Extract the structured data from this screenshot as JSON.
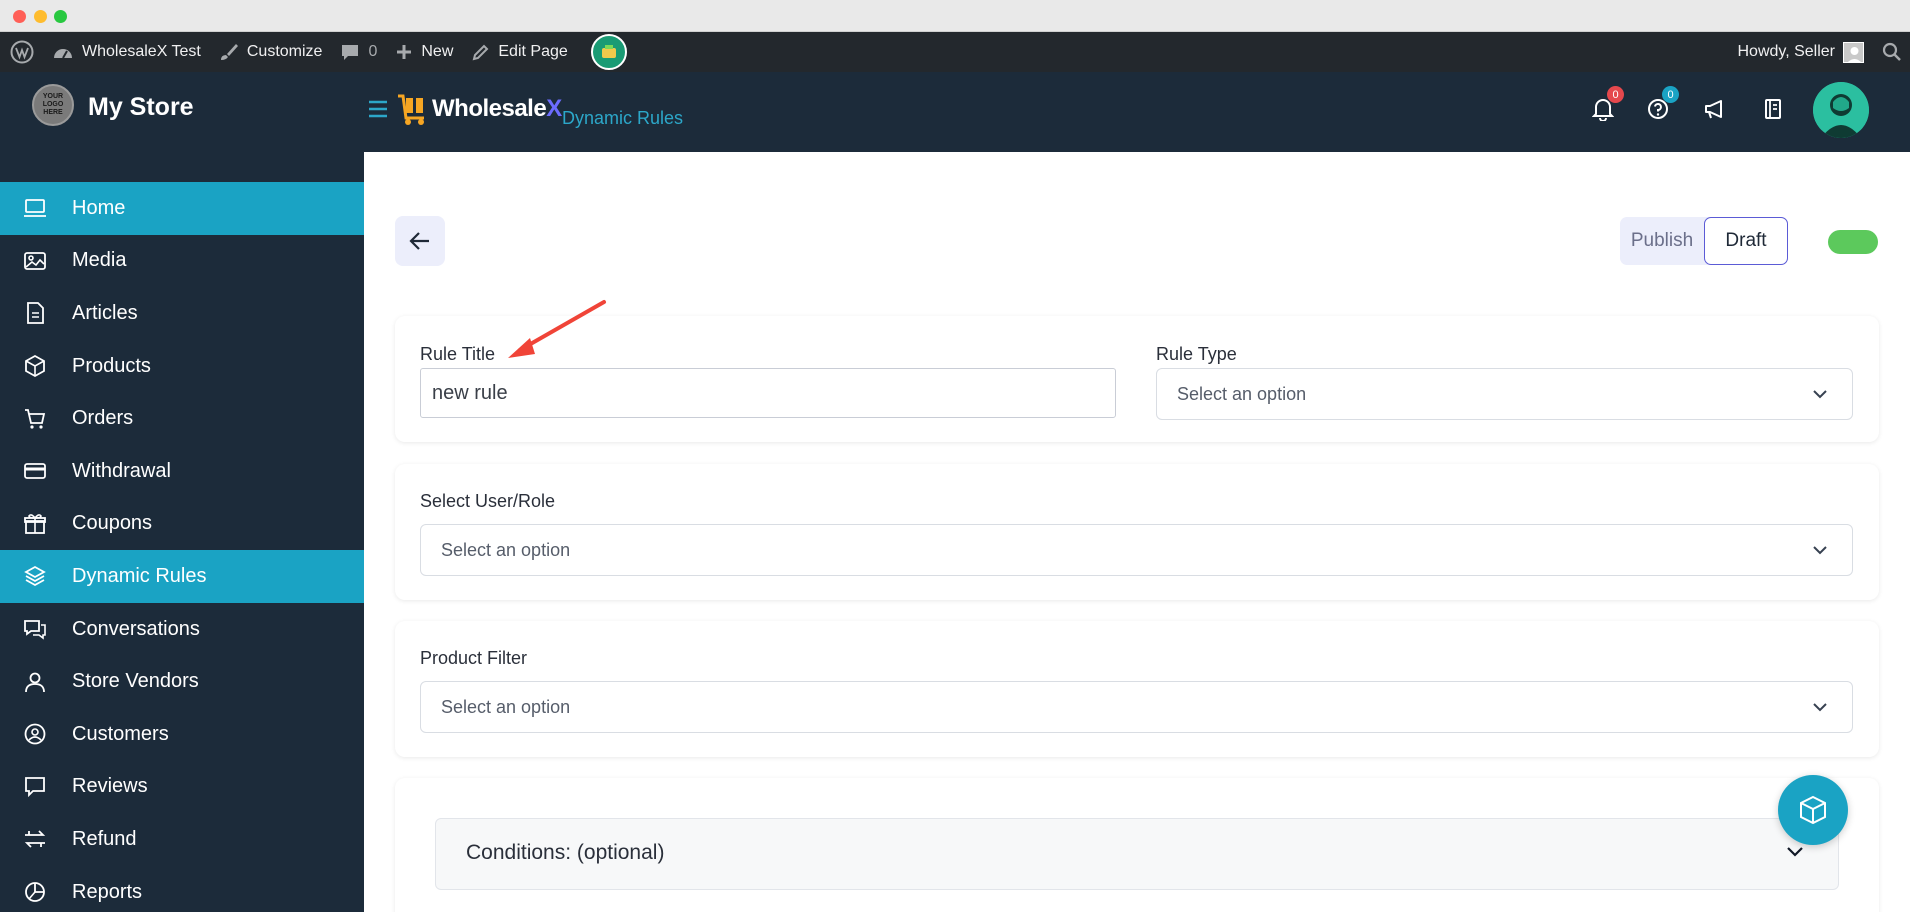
{
  "admin_bar": {
    "site_name": "WholesaleX Test",
    "customize": "Customize",
    "comments_count": "0",
    "new": "New",
    "edit_page": "Edit Page",
    "howdy": "Howdy, Seller"
  },
  "header": {
    "logo_text": "YOUR LOGO HERE",
    "store_name": "My Store",
    "brand": "Wholesale",
    "brand_x": "X",
    "breadcrumb": "Dynamic Rules",
    "notifications_count": "0",
    "help_count": "0"
  },
  "sidebar": {
    "items": [
      {
        "label": "Home",
        "icon": "monitor-icon"
      },
      {
        "label": "Media",
        "icon": "image-icon"
      },
      {
        "label": "Articles",
        "icon": "document-icon"
      },
      {
        "label": "Products",
        "icon": "box-icon"
      },
      {
        "label": "Orders",
        "icon": "cart-icon"
      },
      {
        "label": "Withdrawal",
        "icon": "card-icon"
      },
      {
        "label": "Coupons",
        "icon": "gift-icon"
      },
      {
        "label": "Dynamic Rules",
        "icon": "layers-icon"
      },
      {
        "label": "Conversations",
        "icon": "chat-icon"
      },
      {
        "label": "Store Vendors",
        "icon": "user-icon"
      },
      {
        "label": "Customers",
        "icon": "user-circle-icon"
      },
      {
        "label": "Reviews",
        "icon": "comment-icon"
      },
      {
        "label": "Refund",
        "icon": "refund-icon"
      },
      {
        "label": "Reports",
        "icon": "pie-chart-icon"
      }
    ],
    "active_items": [
      "Home",
      "Dynamic Rules"
    ]
  },
  "form": {
    "publish_label": "Publish",
    "draft_label": "Draft",
    "rule_title_label": "Rule Title",
    "rule_title_value": "new rule",
    "rule_type_label": "Rule Type",
    "rule_type_placeholder": "Select an option",
    "user_role_label": "Select User/Role",
    "user_role_placeholder": "Select an option",
    "product_filter_label": "Product Filter",
    "product_filter_placeholder": "Select an option",
    "conditions_label": "Conditions: (optional)"
  },
  "colors": {
    "sidebar_bg": "#1c2b3a",
    "accent": "#1aa3c4",
    "toggle_on": "#5cc95c",
    "annotation_arrow": "#f04438"
  }
}
